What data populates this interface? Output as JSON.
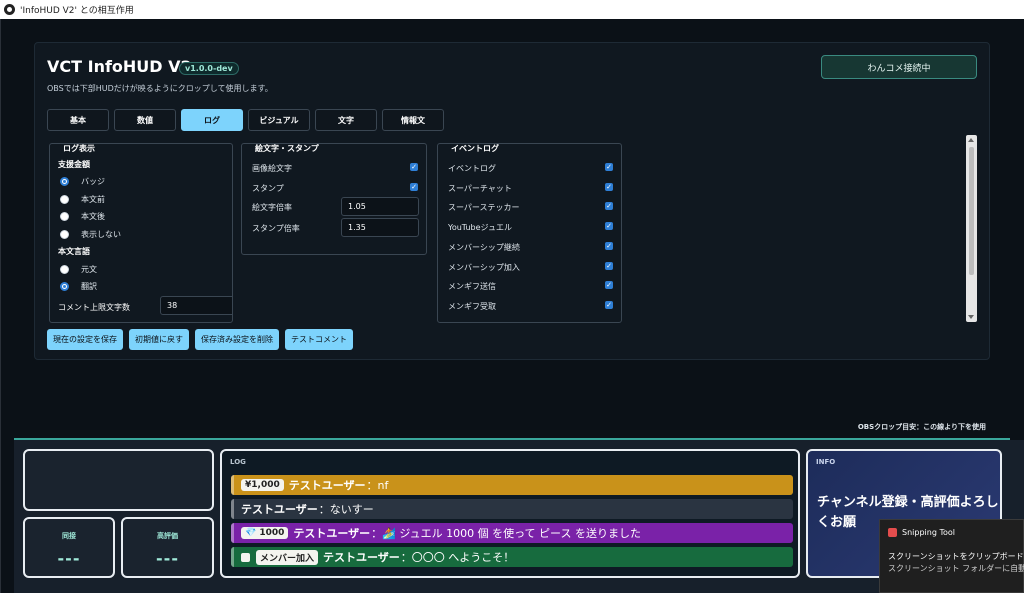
{
  "window": {
    "title": "'InfoHUD V2' との相互作用"
  },
  "header": {
    "title": "VCT InfoHUD V2",
    "version": "v1.0.0-dev",
    "subtitle": "OBSでは下部HUDだけが映るようにクロップして使用します。",
    "connect_button": "わんコメ接続中"
  },
  "tabs": [
    {
      "label": "基本",
      "active": false
    },
    {
      "label": "数値",
      "active": false
    },
    {
      "label": "ログ",
      "active": true
    },
    {
      "label": "ビジュアル",
      "active": false
    },
    {
      "label": "文字",
      "active": false
    },
    {
      "label": "情報文",
      "active": false
    }
  ],
  "log_display": {
    "title": "ログ表示",
    "support_label": "支援金額",
    "support_options": [
      "バッジ",
      "本文前",
      "本文後",
      "表示しない"
    ],
    "support_selected": "バッジ",
    "language_label": "本文言語",
    "language_options": [
      "元文",
      "翻訳"
    ],
    "language_selected": "翻訳",
    "max_chars_label": "コメント上限文字数",
    "max_chars_value": "38"
  },
  "emoji_stamp": {
    "title": "絵文字・スタンプ",
    "emoji_label": "画像絵文字",
    "emoji_checked": true,
    "stamp_label": "スタンプ",
    "stamp_checked": true,
    "emoji_scale_label": "絵文字倍率",
    "emoji_scale_value": "1.05",
    "stamp_scale_label": "スタンプ倍率",
    "stamp_scale_value": "1.35"
  },
  "event_log": {
    "title": "イベントログ",
    "items": [
      {
        "label": "イベントログ",
        "checked": true
      },
      {
        "label": "スーパーチャット",
        "checked": true
      },
      {
        "label": "スーパーステッカー",
        "checked": true
      },
      {
        "label": "YouTubeジュエル",
        "checked": true
      },
      {
        "label": "メンバーシップ継続",
        "checked": true
      },
      {
        "label": "メンバーシップ加入",
        "checked": true
      },
      {
        "label": "メンギフ送信",
        "checked": true
      },
      {
        "label": "メンギフ受取",
        "checked": true
      }
    ]
  },
  "actions": [
    "現在の設定を保存",
    "初期値に戻す",
    "保存済み設定を削除",
    "テストコメント"
  ],
  "crop_note": "OBSクロップ目安：この線より下を使用",
  "hud": {
    "stats": [
      {
        "label": "同接",
        "value": "---"
      },
      {
        "label": "高評価",
        "value": "---"
      }
    ],
    "log_label": "LOG",
    "log_rows": [
      {
        "chip": "¥1,000",
        "user": "テストユーザー",
        "text": "：nf",
        "color": "#c9921a"
      },
      {
        "chip": "",
        "user": "テストユーザー",
        "text": "：ないすー",
        "color": "#2a3441"
      },
      {
        "chip": "💎 1000",
        "user": "テストユーザー",
        "text": "：🏄 ジュエル 1000 個 を使って ピース を送りました",
        "color": "#7a22a8"
      },
      {
        "chip": "メンバー加入",
        "user": "テストユーザー",
        "text": "：〇〇〇 へようこそ！",
        "color": "#176b3e"
      }
    ],
    "info_label": "INFO",
    "info_text": "チャンネル登録・高評価よろしくお願"
  },
  "toast": {
    "title": "Snipping Tool",
    "line1": "スクリーンショットをクリップボードにコピーし",
    "line2": "スクリーンショット フォルダーに自動的に保"
  }
}
